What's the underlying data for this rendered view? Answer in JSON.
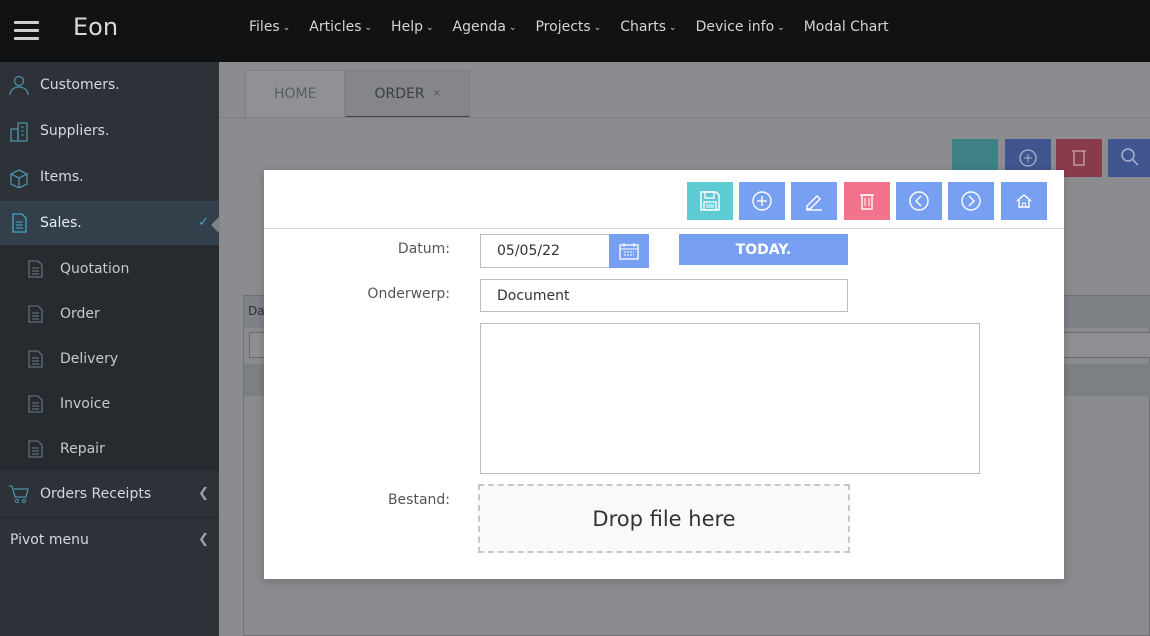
{
  "brand": "Eon",
  "topnav": [
    {
      "label": "Files",
      "caret": true
    },
    {
      "label": "Articles",
      "caret": true
    },
    {
      "label": "Help",
      "caret": true
    },
    {
      "label": "Agenda",
      "caret": true
    },
    {
      "label": "Projects",
      "caret": true
    },
    {
      "label": "Charts",
      "caret": true
    },
    {
      "label": "Device info",
      "caret": true
    },
    {
      "label": "Modal Chart",
      "caret": false
    }
  ],
  "sidebar": {
    "items": [
      {
        "label": "Customers.",
        "icon": "user-icon"
      },
      {
        "label": "Suppliers.",
        "icon": "building-icon"
      },
      {
        "label": "Items.",
        "icon": "box-icon"
      },
      {
        "label": "Sales.",
        "icon": "document-icon",
        "active": true
      }
    ],
    "sales_sub": [
      {
        "label": "Quotation"
      },
      {
        "label": "Order"
      },
      {
        "label": "Delivery"
      },
      {
        "label": "Invoice"
      },
      {
        "label": "Repair"
      }
    ],
    "orders_receipts": "Orders Receipts",
    "pivot_menu": "Pivot menu"
  },
  "tabs": {
    "home": "HOME",
    "order": "ORDER",
    "close_glyph": "×"
  },
  "grid": {
    "header_partial": "Da"
  },
  "modal": {
    "toolbar": [
      "save-icon",
      "add-icon",
      "edit-icon",
      "delete-icon",
      "previous-icon",
      "next-icon",
      "home-icon"
    ],
    "datum_label": "Datum:",
    "datum_value": "05/05/22",
    "today_label": "TODAY.",
    "onderwerp_label": "Onderwerp:",
    "onderwerp_value": "Document",
    "bestand_label": "Bestand:",
    "dropzone_text": "Drop file here"
  },
  "colors": {
    "teal": "#5ccbd4",
    "blue": "#78a0f2",
    "red": "#f2738b",
    "topbar": "#111213",
    "sidebar": "#2c3238"
  }
}
